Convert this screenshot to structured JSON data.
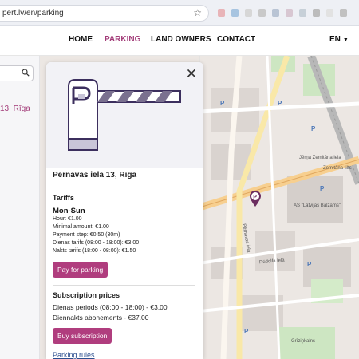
{
  "browser": {
    "url": "pert.lv/en/parking",
    "extension_colors": [
      "#e8b4b8",
      "#a7c4e0",
      "#d7d7d7",
      "#c9c9c9",
      "#b9c4d4",
      "#d8c7d2",
      "#c7d0d8",
      "#bcbcbc",
      "#e2e2e2",
      "#c1c1c1"
    ]
  },
  "nav": {
    "items": [
      {
        "label": "HOME"
      },
      {
        "label": "PARKING"
      },
      {
        "label": "LAND OWNERS"
      },
      {
        "label": "CONTACT"
      }
    ],
    "active_index": 1,
    "language": "EN"
  },
  "sidebar": {
    "address_fragment": "13, Rīga"
  },
  "panel": {
    "address": "Pērnavas iela 13, Rīga",
    "tariffs_title": "Tariffs",
    "days": "Mon-Sun",
    "tariff_lines": [
      "Hour: €1.00",
      "Minimal amount: €1.00",
      "Payment step: €0.50 (30m)",
      "Dienas tarifs (08:00 - 18:00): €3.00",
      "Nakts tarifs (18:00 - 08:00): €1.50"
    ],
    "pay_button": "Pay for parking",
    "subscription_title": "Subscription prices",
    "subscription_lines": [
      "Dienas periods (08:00 - 18:00) - €3.00",
      "Diennakts abonements - €37.00"
    ],
    "buy_button": "Buy subscription",
    "rules_link": "Parking rules"
  },
  "map": {
    "labels": {
      "street1": "Jērņa Zemitāna iela",
      "street2": "Pērnavas iela",
      "street3": "Zemitāna tilts",
      "street4": "Rūdolfa iela",
      "building": "AS \"Latvijas Balzams\"",
      "place": "Grīziņkalns"
    }
  },
  "colors": {
    "accent": "#a23b78",
    "button": "#b03d7e",
    "link": "#2c4f8f"
  }
}
